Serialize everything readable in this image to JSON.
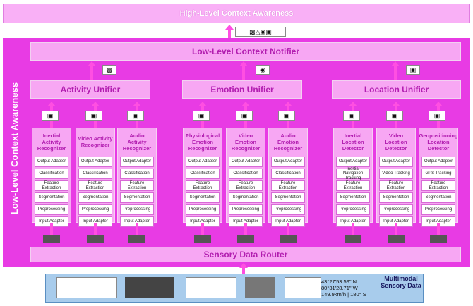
{
  "high_level": "High-Level Context Awareness",
  "low_level": "Low-Level Context Awareness",
  "notifier": "Low-Level Context Notifier",
  "unifiers": [
    "Activity Unifier",
    "Emotion Unifier",
    "Location Unifier"
  ],
  "recognizers": [
    {
      "title": "Inertial Activity Recognizer",
      "stages": [
        "Output Adapter",
        "Classification",
        "Feature Extraction",
        "Segmentation",
        "Preprocessing",
        "Input Adapter"
      ]
    },
    {
      "title": "Video Activity Recognizer",
      "stages": [
        "Output Adapter",
        "Classification",
        "Feature Extraction",
        "Segmentation",
        "Preprocessing",
        "Input Adapter"
      ]
    },
    {
      "title": "Audio Activity Recognizer",
      "stages": [
        "Output Adapter",
        "Classification",
        "Feature Extraction",
        "Segmentation",
        "Preprocessing",
        "Input Adapter"
      ]
    },
    {
      "title": "Physiological Emotion Recognizer",
      "stages": [
        "Output Adapter",
        "Classification",
        "Feature Extraction",
        "Segmentation",
        "Preprocessing",
        "Input Adapter"
      ]
    },
    {
      "title": "Video Emotion Recognizer",
      "stages": [
        "Output Adapter",
        "Classification",
        "Feature Extraction",
        "Segmentation",
        "Preprocessing",
        "Input Adapter"
      ]
    },
    {
      "title": "Audio Emotion Recognizer",
      "stages": [
        "Output Adapter",
        "Classification",
        "Feature Extraction",
        "Segmentation",
        "Preprocessing",
        "Input Adapter"
      ]
    },
    {
      "title": "Inertial Location Detector",
      "stages": [
        "Output Adapter",
        "Inertial Navigation Tracking",
        "Feature Extraction",
        "Segmentation",
        "Preprocessing",
        "Input Adapter"
      ]
    },
    {
      "title": "Video Location Detector",
      "stages": [
        "Output Adapter",
        "Video Tracking",
        "Feature Extraction",
        "Segmentation",
        "Preprocessing",
        "Input Adapter"
      ]
    },
    {
      "title": "Geopositioning Location Detector",
      "stages": [
        "Output Adapter",
        "GPS Tracking",
        "Feature Extraction",
        "Segmentation",
        "Preprocessing",
        "Input Adapter"
      ]
    }
  ],
  "router": "Sensory Data Router",
  "multimodal": "Multimodal Sensory Data",
  "gps_lines": [
    "43°27'53.59\" N",
    "80°31'28.71\" W",
    "149.9km/h | 180° S"
  ],
  "colors": {
    "frame": "#e83be4",
    "box": "#f7a7f3",
    "arrow": "#ff4fe2",
    "sensor_bar": "#a8ccec"
  }
}
